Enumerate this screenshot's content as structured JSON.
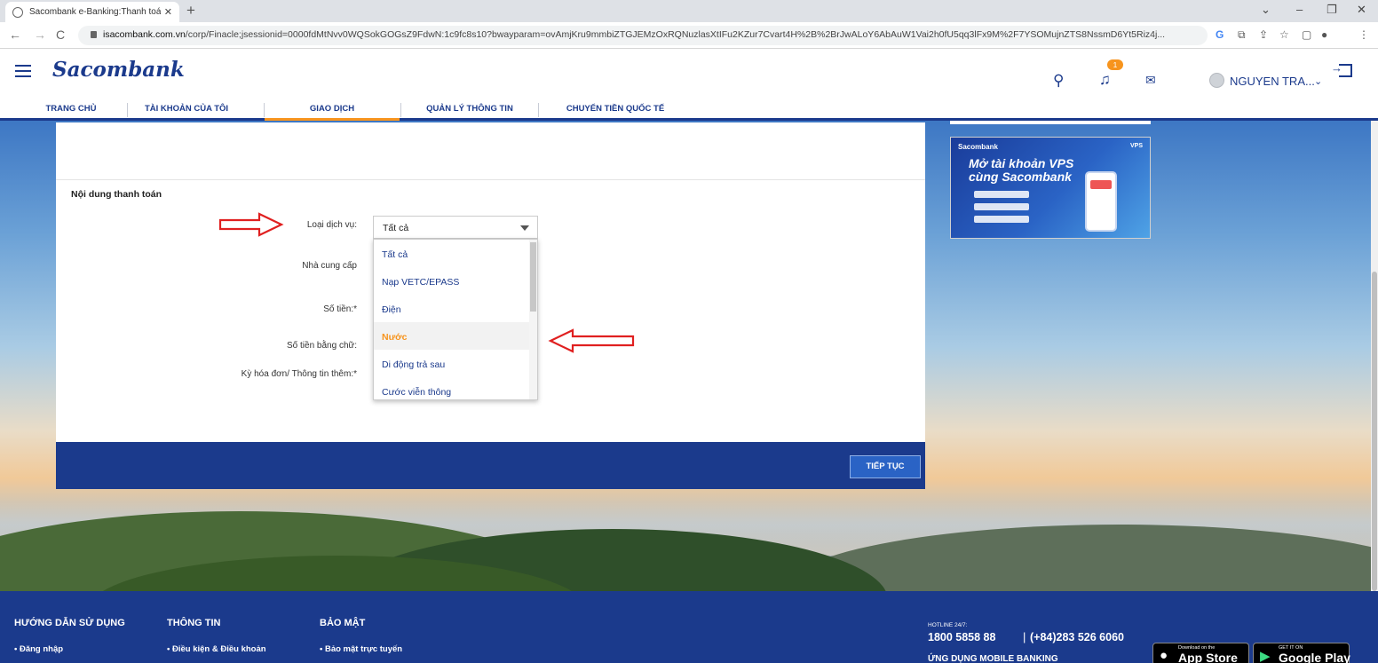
{
  "browser": {
    "tab_title": "Sacombank e-Banking:Thanh toá",
    "tab_close": "✕",
    "new_tab": "+",
    "url_host": "isacombank.com.vn",
    "url_path": "/corp/Finacle;jsessionid=0000fdMtNvv0WQSokGOGsZ9FdwN:1c9fc8s10?bwayparam=ovAmjKru9mmbiZTGJEMzOxRQNuzlasXtIFu2KZur7Cvart4H%2B%2BrJwALoY6AbAuW1Vai2h0fU5qq3lFx9M%2F7YSOMujnZTS8NssmD6Yt5Riz4j...",
    "back": "←",
    "forward": "→",
    "reload": "C"
  },
  "header": {
    "logo": "Sacombank",
    "notification_count": "1",
    "username": "NGUYEN TRA...",
    "nav": [
      "TRANG CHỦ",
      "TÀI KHOẢN CỦA TÔI",
      "GIAO DỊCH",
      "QUẢN LÝ THÔNG TIN",
      "CHUYỂN TIỀN QUỐC TẾ"
    ],
    "active_nav": "GIAO DỊCH"
  },
  "form": {
    "section_title": "Nội dung thanh toán",
    "label_service": "Loại dịch vụ:",
    "label_provider": "Nhà cung cấp",
    "label_amount": "Số tiền:*",
    "label_amount_words": "Số tiền bằng chữ:",
    "label_bill": "Kỳ hóa đơn/ Thông tin thêm:*",
    "service_selected": "Tất cả",
    "service_options": [
      "Tất cả",
      "Nạp VETC/EPASS",
      "Điện",
      "Nước",
      "Di động trả sau",
      "Cước viễn thông"
    ],
    "highlighted_option": "Nước",
    "continue_button": "TIẾP TỤC"
  },
  "ad": {
    "brand": "Sacombank",
    "tag": "VPS",
    "headline_1": "Mở tài khoản VPS",
    "headline_2": "cùng Sacombank"
  },
  "footer": {
    "col1_title": "HƯỚNG DẪN SỬ DỤNG",
    "col1_link": "• Đăng nhập",
    "col2_title": "THÔNG TIN",
    "col2_link": "• Điều kiện & Điều khoản",
    "col3_title": "BẢO MẬT",
    "col3_link": "• Bảo mật trực tuyến",
    "hotline_label": "HOTLINE 24/7:",
    "hotline": "1800 5858 88",
    "hotline_sep": "|",
    "hotline_intl": "(+84)283 526 6060",
    "mobile_label": "ỨNG DỤNG MOBILE BANKING",
    "appstore_small": "Download on the",
    "appstore_big": "App Store",
    "gplay_small": "GET IT ON",
    "gplay_big": "Google Play"
  },
  "colors": {
    "brand_blue": "#1b3a8c",
    "accent_orange": "#f7941d",
    "annotation_red": "#e02020"
  }
}
